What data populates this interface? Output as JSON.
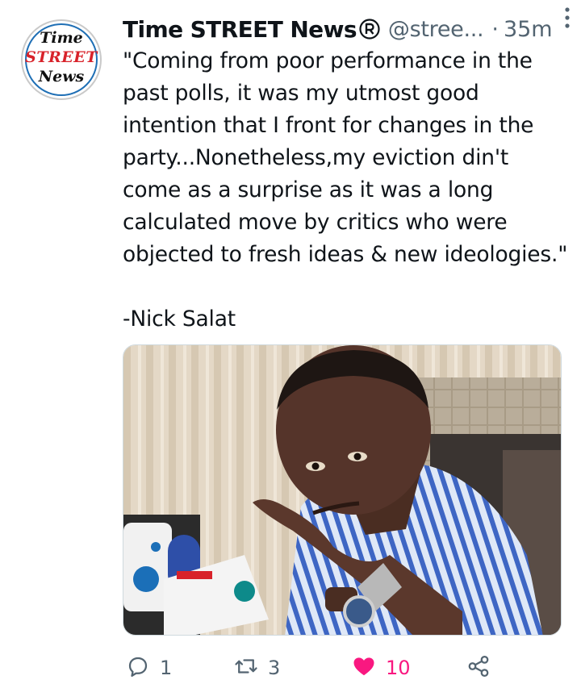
{
  "author": {
    "avatar_logo": [
      "Time",
      "STREET",
      "News"
    ],
    "name": "Time STREET News",
    "handle": "@stree...",
    "separator": "·",
    "time": "35m"
  },
  "tweet": {
    "lines": [
      "\"Coming from poor performance in the",
      "past polls, it was my utmost good",
      "intention that I front for changes in the",
      "party...Nonetheless,my eviction din't",
      "come as a surprise as it was a long",
      "calculated move by critics who were",
      "objected to fresh ideas & new ideologies.\""
    ],
    "signature": "-Nick Salat"
  },
  "icons": {
    "registered": "registered-icon",
    "more": "more-vertical-icon",
    "reply": "reply-icon",
    "retweet": "retweet-icon",
    "like": "heart-filled-icon",
    "share": "share-icon"
  },
  "actions": {
    "replies": "1",
    "retweets": "3",
    "likes": "10"
  },
  "colors": {
    "text": "#0f1419",
    "secondary": "#536471",
    "like": "#f91880",
    "avatar_red": "#d8222a"
  }
}
